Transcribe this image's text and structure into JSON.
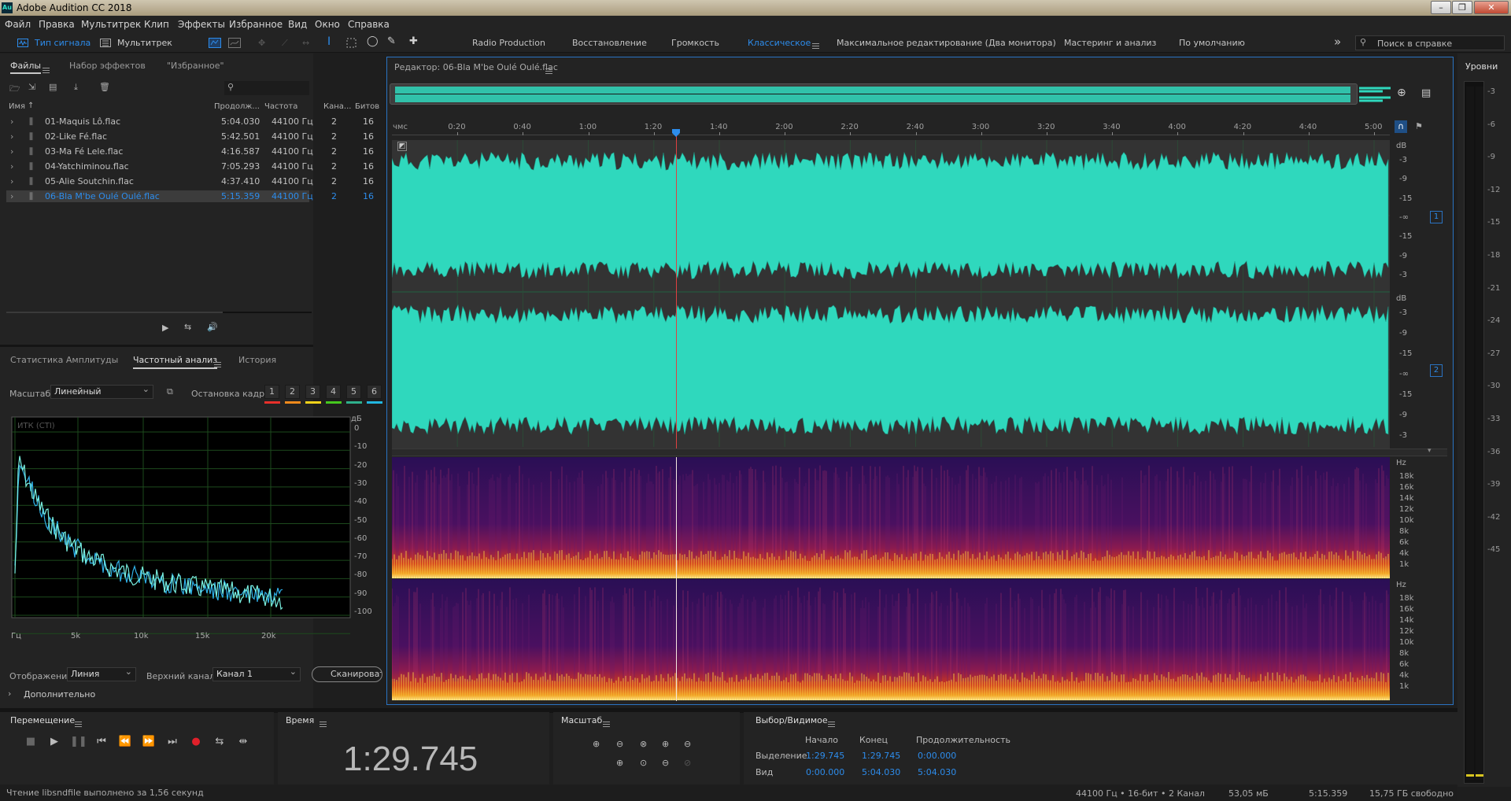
{
  "window": {
    "title": "Adobe Audition CC 2018",
    "logo": "Au",
    "controls": [
      "minimize",
      "restore",
      "close"
    ]
  },
  "menu": [
    "Файл",
    "Правка",
    "Мультитрек",
    "Клип",
    "Эффекты",
    "Избранное",
    "Вид",
    "Окно",
    "Справка"
  ],
  "toolbar": {
    "waveform_label": "Тип сигнала",
    "multitrack_label": "Мультитрек",
    "workspaces": [
      "Radio Production",
      "Восстановление",
      "Громкость",
      "Классическое",
      "Максимальное редактирование (Два монитора)",
      "Мастеринг и анализ",
      "По умолчанию"
    ],
    "active_workspace": "Классическое",
    "more": "»",
    "help_placeholder": "Поиск в справке"
  },
  "files_panel": {
    "tabs": [
      "Файлы",
      "Набор эффектов",
      "\"Избранное\""
    ],
    "columns": [
      "Имя",
      "Продолж...",
      "Частота",
      "Кана...",
      "Битов"
    ],
    "files": [
      {
        "name": "01-Maquis Lô.flac",
        "duration": "5:04.030",
        "rate": "44100 Гц",
        "channels": "2",
        "bits": "16"
      },
      {
        "name": "02-Like Fé.flac",
        "duration": "5:42.501",
        "rate": "44100 Гц",
        "channels": "2",
        "bits": "16"
      },
      {
        "name": "03-Ma Fé Lele.flac",
        "duration": "4:16.587",
        "rate": "44100 Гц",
        "channels": "2",
        "bits": "16"
      },
      {
        "name": "04-Yatchiminou.flac",
        "duration": "7:05.293",
        "rate": "44100 Гц",
        "channels": "2",
        "bits": "16"
      },
      {
        "name": "05-Alie Soutchin.flac",
        "duration": "4:37.410",
        "rate": "44100 Гц",
        "channels": "2",
        "bits": "16"
      },
      {
        "name": "06-Bla M'be Oulé Oulé.flac",
        "duration": "5:15.359",
        "rate": "44100 Гц",
        "channels": "2",
        "bits": "16"
      }
    ],
    "selected_index": 5
  },
  "analysis_panel": {
    "tabs": [
      "Статистика Амплитуды",
      "Частотный анализ",
      "История"
    ],
    "active_tab": "Частотный анализ",
    "scale_label": "Масштаб:",
    "scale_value": "Линейный",
    "hold_label": "Остановка кадра:",
    "hold_buttons": [
      "1",
      "2",
      "3",
      "4",
      "5",
      "6"
    ],
    "hold_colors": [
      "#e8302a",
      "#f08a1c",
      "#f2d21a",
      "#46c81e",
      "#2fb08c",
      "#22b6e0"
    ],
    "plot_label": "ИТК (СТI)",
    "y_unit": "дБ",
    "y_ticks": [
      "0",
      "-10",
      "-20",
      "-30",
      "-40",
      "-50",
      "-60",
      "-70",
      "-80",
      "-90",
      "-100"
    ],
    "x_ticks": [
      "Гц",
      "5k",
      "10k",
      "15k",
      "20k"
    ],
    "display_label": "Отображение:",
    "display_value": "Линия",
    "channel_label": "Верхний канал:",
    "channel_value": "Канал 1",
    "scan_button": "Сканировать",
    "advanced": "Дополнительно"
  },
  "editor": {
    "title": "Редактор: 06-Bla M'be Oulé Oulé.flac",
    "ruler_unit": "чмс",
    "ruler_ticks": [
      "0:20",
      "0:40",
      "1:00",
      "1:20",
      "1:40",
      "2:00",
      "2:20",
      "2:40",
      "3:00",
      "3:20",
      "3:40",
      "4:00",
      "4:20",
      "4:40",
      "5:00"
    ],
    "db_unit": "dB",
    "db_ticks": [
      "-3",
      "-9",
      "-15",
      "-∞",
      "-15",
      "-9",
      "-3"
    ],
    "hz_unit": "Hz",
    "hz_ticks": [
      "18k",
      "16k",
      "14k",
      "12k",
      "10k",
      "8k",
      "6k",
      "4k",
      "1k"
    ],
    "channels": [
      "1",
      "2"
    ],
    "playhead_fraction": 0.2848,
    "wave_color": "#2fd8bd"
  },
  "levels": {
    "title": "Уровни",
    "ticks": [
      "-3",
      "-6",
      "-9",
      "-12",
      "-15",
      "-18",
      "-21",
      "-24",
      "-27",
      "-30",
      "-33",
      "-36",
      "-39",
      "-42",
      "-45"
    ]
  },
  "transport": {
    "title": "Перемещение"
  },
  "time": {
    "title": "Время",
    "value": "1:29.745"
  },
  "zoom": {
    "title": "Масштаб"
  },
  "selection": {
    "title": "Выбор/Видимое",
    "headers": [
      "Начало",
      "Конец",
      "Продолжительность"
    ],
    "rows": [
      {
        "label": "Выделение",
        "start": "1:29.745",
        "end": "1:29.745",
        "duration": "0:00.000"
      },
      {
        "label": "Вид",
        "start": "0:00.000",
        "end": "5:04.030",
        "duration": "5:04.030"
      }
    ]
  },
  "status": {
    "message": "Чтение libsndfile выполнено за 1,56 секунд",
    "format": "44100 Гц • 16-бит • 2 Канал",
    "size": "53,05 мБ",
    "duration": "5:15.359",
    "free": "15,75 ГБ свободно"
  }
}
